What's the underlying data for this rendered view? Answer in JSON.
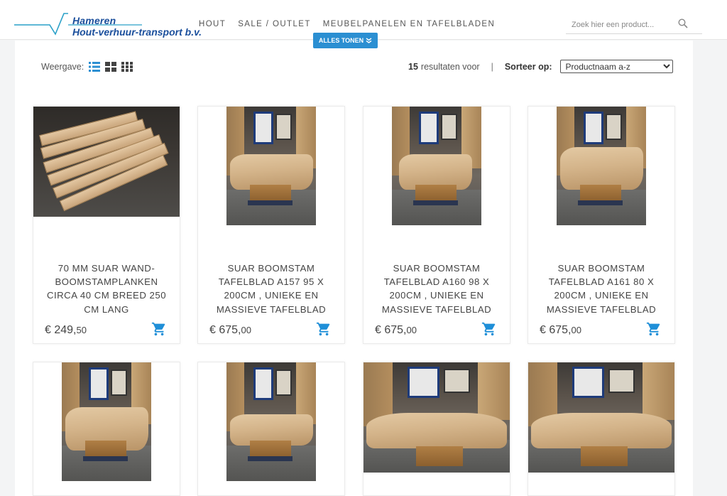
{
  "brand": {
    "line1": "Hameren",
    "line2": "Hout-verhuur-transport b.v.",
    "color": "#1b4f9c"
  },
  "nav": {
    "items": [
      "HOUT",
      "SALE / OUTLET",
      "MEUBELPANELEN EN TAFELBLADEN"
    ],
    "show_all": "ALLES TONEN"
  },
  "search": {
    "placeholder": "Zoek hier een product..."
  },
  "toolbar": {
    "view_label": "Weergave:",
    "result_count": "15",
    "result_text": "resultaten voor",
    "separator": "|",
    "sort_label": "Sorteer op:",
    "sort_selected": "Productnaam a-z"
  },
  "colors": {
    "accent": "#2b8fd2",
    "cart": "#1f8fd8"
  },
  "products": [
    {
      "title": "70 MM SUAR WAND-BOOMSTAMPLANKEN CIRCA 40 CM BREED 250 CM LANG",
      "price_int": "€ 249,",
      "price_cents": "50"
    },
    {
      "title": "SUAR BOOMSTAM TAFELBLAD A157 95 X 200CM , UNIEKE EN MASSIEVE TAFELBLAD",
      "price_int": "€ 675,",
      "price_cents": "00"
    },
    {
      "title": "SUAR BOOMSTAM TAFELBLAD A160 98 X 200CM , UNIEKE EN MASSIEVE TAFELBLAD",
      "price_int": "€ 675,",
      "price_cents": "00"
    },
    {
      "title": "SUAR BOOMSTAM TAFELBLAD A161 80 X 200CM , UNIEKE EN MASSIEVE TAFELBLAD",
      "price_int": "€ 675,",
      "price_cents": "00"
    }
  ]
}
